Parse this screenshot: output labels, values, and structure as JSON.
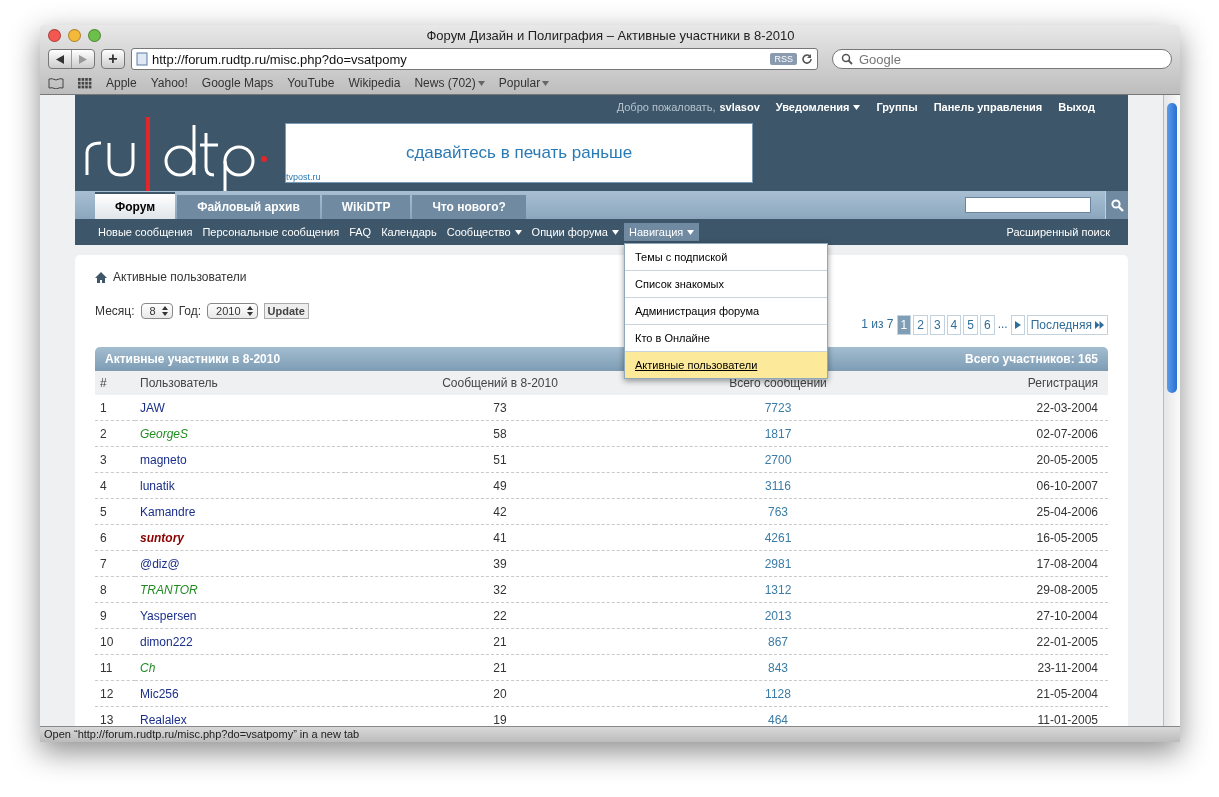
{
  "window": {
    "title": "Форум Дизайн и Полиграфия – Активные участники в 8-2010"
  },
  "toolbar": {
    "add_label": "+",
    "url": "http://forum.rudtp.ru/misc.php?do=vsatpomy",
    "rss": "RSS",
    "search_placeholder": "Google"
  },
  "bookmarks": [
    {
      "label": "Apple",
      "menu": false
    },
    {
      "label": "Yahoo!",
      "menu": false
    },
    {
      "label": "Google Maps",
      "menu": false
    },
    {
      "label": "YouTube",
      "menu": false
    },
    {
      "label": "Wikipedia",
      "menu": false
    },
    {
      "label": "News (702)",
      "menu": true
    },
    {
      "label": "Popular",
      "menu": true
    }
  ],
  "header": {
    "welcome": "Добро пожаловать,",
    "username": "svlasov",
    "user_links": [
      {
        "label": "Уведомления",
        "menu": true
      },
      {
        "label": "Группы",
        "menu": false
      },
      {
        "label": "Панель управления",
        "menu": false
      },
      {
        "label": "Выход",
        "menu": false
      }
    ],
    "banner_text": "сдавайтесь в печать раньше",
    "banner_caption": "tvpost.ru"
  },
  "tabs": [
    {
      "label": "Форум",
      "selected": true
    },
    {
      "label": "Файловый архив",
      "selected": false
    },
    {
      "label": "WikiDTP",
      "selected": false
    },
    {
      "label": "Что нового?",
      "selected": false
    }
  ],
  "subnav": [
    {
      "label": "Новые сообщения",
      "menu": false,
      "selected": false
    },
    {
      "label": "Персональные сообщения",
      "menu": false,
      "selected": false
    },
    {
      "label": "FAQ",
      "menu": false,
      "selected": false
    },
    {
      "label": "Календарь",
      "menu": false,
      "selected": false
    },
    {
      "label": "Сообщество",
      "menu": true,
      "selected": false
    },
    {
      "label": "Опции форума",
      "menu": true,
      "selected": false
    },
    {
      "label": "Навигация",
      "menu": true,
      "selected": true
    }
  ],
  "advanced_search": "Расширенный поиск",
  "dropdown": [
    {
      "label": "Темы с подпиской",
      "selected": false
    },
    {
      "label": "Список знакомых",
      "selected": false
    },
    {
      "label": "Администрация форума",
      "selected": false
    },
    {
      "label": "Кто в Онлайне",
      "selected": false
    },
    {
      "label": "Активные пользователи",
      "selected": true
    }
  ],
  "breadcrumb": "Активные пользователи",
  "filter": {
    "month_label": "Месяц:",
    "month": "8",
    "year_label": "Год:",
    "year": "2010",
    "button": "Update"
  },
  "pagination": {
    "info": "1 из 7",
    "pages": [
      {
        "label": "1",
        "selected": true
      },
      {
        "label": "2",
        "selected": false
      },
      {
        "label": "3",
        "selected": false
      },
      {
        "label": "4",
        "selected": false
      },
      {
        "label": "5",
        "selected": false
      },
      {
        "label": "6",
        "selected": false
      }
    ],
    "ellipsis": "...",
    "last": "Последняя"
  },
  "table": {
    "title": "Активные участники в 8-2010",
    "total": "Всего участников: 165",
    "columns": [
      "#",
      "Пользователь",
      "Сообщений в 8-2010",
      "Всего сообщений",
      "Регистрация"
    ],
    "rows": [
      {
        "n": "1",
        "user": "JAW",
        "kind": "member",
        "month": "73",
        "total": "7723",
        "reg": "22-03-2004"
      },
      {
        "n": "2",
        "user": "GeorgeS",
        "kind": "moderator",
        "month": "58",
        "total": "1817",
        "reg": "02-07-2006"
      },
      {
        "n": "3",
        "user": "magneto",
        "kind": "member",
        "month": "51",
        "total": "2700",
        "reg": "20-05-2005"
      },
      {
        "n": "4",
        "user": "lunatik",
        "kind": "member",
        "month": "49",
        "total": "3116",
        "reg": "06-10-2007"
      },
      {
        "n": "5",
        "user": "Kamandre",
        "kind": "member",
        "month": "42",
        "total": "763",
        "reg": "25-04-2006"
      },
      {
        "n": "6",
        "user": "suntory",
        "kind": "admin",
        "month": "41",
        "total": "4261",
        "reg": "16-05-2005"
      },
      {
        "n": "7",
        "user": "@diz@",
        "kind": "member",
        "month": "39",
        "total": "2981",
        "reg": "17-08-2004"
      },
      {
        "n": "8",
        "user": "TRANTOR",
        "kind": "moderator",
        "month": "32",
        "total": "1312",
        "reg": "29-08-2005"
      },
      {
        "n": "9",
        "user": "Yaspersen",
        "kind": "member",
        "month": "22",
        "total": "2013",
        "reg": "27-10-2004"
      },
      {
        "n": "10",
        "user": "dimon222",
        "kind": "member",
        "month": "21",
        "total": "867",
        "reg": "22-01-2005"
      },
      {
        "n": "11",
        "user": "Ch",
        "kind": "moderator",
        "month": "21",
        "total": "843",
        "reg": "23-11-2004"
      },
      {
        "n": "12",
        "user": "Mic256",
        "kind": "member",
        "month": "20",
        "total": "1128",
        "reg": "21-05-2004"
      },
      {
        "n": "13",
        "user": "Realalex",
        "kind": "member",
        "month": "19",
        "total": "464",
        "reg": "11-01-2005"
      }
    ]
  },
  "status_bar": "Open “http://forum.rudtp.ru/misc.php?do=vsatpomy” in a new tab"
}
